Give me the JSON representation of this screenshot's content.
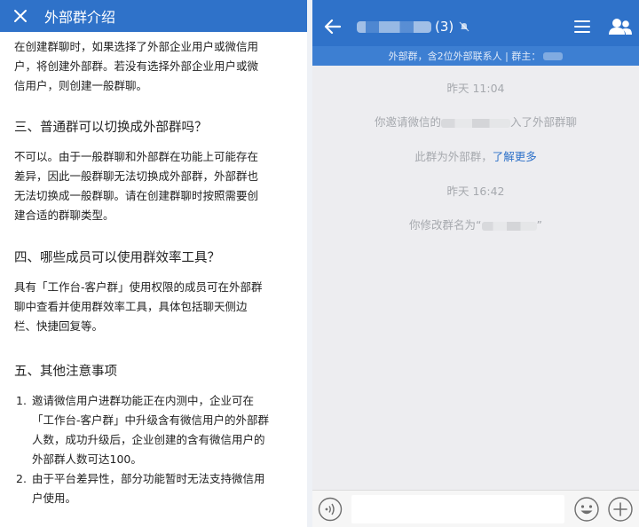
{
  "left": {
    "title": "外部群介绍",
    "intro_lines": [
      "在创建群聊时，如果选择了外部企业用户或微信用",
      "户，将创建外部群。若没有选择外部企业用户或微",
      "信用户，则创建一般群聊。"
    ],
    "section3": {
      "heading": "三、普通群可以切换成外部群吗？",
      "lines": [
        "不可以。由于一般群聊和外部群在功能上可能存在",
        "差异，因此一般群聊无法切换成外部群，外部群也",
        "无法切换成一般群聊。请在创建群聊时按照需要创",
        "建合适的群聊类型。"
      ]
    },
    "section4": {
      "heading": "四、哪些成员可以使用群效率工具？",
      "lines": [
        "具有「工作台-客户群」使用权限的成员可在外部群",
        "聊中查看并使用群效率工具，具体包括聊天侧边",
        "栏、快捷回复等。"
      ]
    },
    "section5": {
      "heading": "五、其他注意事项",
      "items": [
        {
          "num": "1.",
          "lines": [
            "邀请微信用户进群功能正在内测中，企业可在",
            "「工作台-客户群」中升级含有微信用户的外部群",
            "人数，成功升级后，企业创建的含有微信用户的",
            "外部群人数可达100。"
          ]
        },
        {
          "num": "2.",
          "lines": [
            "由于平台差异性，部分功能暂时无法支持微信用",
            "户使用。"
          ]
        }
      ]
    }
  },
  "right": {
    "header": {
      "count": "(3)"
    },
    "info_bar": {
      "text": "外部群，含2位外部联系人 | 群主："
    },
    "messages": {
      "time1": "昨天  11:04",
      "invite_prefix": "你邀请微信的",
      "invite_suffix": "入了外部群聊",
      "notice_text": "此群为外部群，",
      "notice_link": "了解更多",
      "time2": "昨天  16:42",
      "rename_prefix": "你修改群名为“",
      "rename_suffix": "”"
    }
  },
  "colors": {
    "accent": "#2f72c9",
    "info_bar": "#3d7fd2",
    "chat_bg": "#ededf0",
    "system_text": "#a6a9ae"
  }
}
